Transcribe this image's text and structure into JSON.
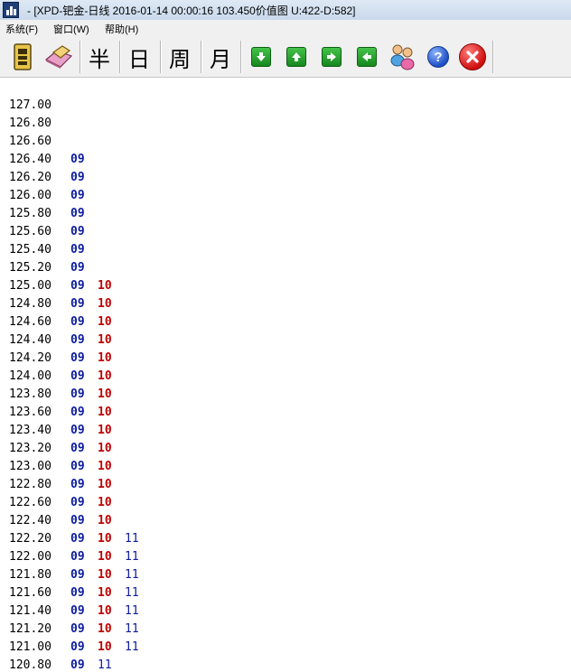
{
  "window": {
    "title": "- [XPD-钯金-日线 2016-01-14 00:00:16 103.450价值图 U:422-D:582]"
  },
  "menu": {
    "items": [
      "系统(F)",
      "窗口(W)",
      "帮助(H)"
    ]
  },
  "toolbar": {
    "buttons": [
      {
        "icon": "database-icon"
      },
      {
        "icon": "eraser-icon"
      },
      {
        "label": "半"
      },
      {
        "label": "日"
      },
      {
        "label": "周"
      },
      {
        "label": "月"
      },
      {
        "icon": "arrow-down-icon"
      },
      {
        "icon": "arrow-up-icon"
      },
      {
        "icon": "arrow-right-icon"
      },
      {
        "icon": "arrow-left-icon"
      },
      {
        "icon": "users-icon"
      },
      {
        "icon": "help-icon",
        "label": "?"
      },
      {
        "icon": "close-icon"
      }
    ]
  },
  "colors": {
    "c09": "#0b1ba0",
    "c10": "#c00000",
    "c11": "#0b1ba0"
  },
  "rows": [
    {
      "price": "127.00",
      "cols": []
    },
    {
      "price": "126.80",
      "cols": []
    },
    {
      "price": "126.60",
      "cols": []
    },
    {
      "price": "126.40",
      "cols": [
        "09"
      ]
    },
    {
      "price": "126.20",
      "cols": [
        "09"
      ]
    },
    {
      "price": "126.00",
      "cols": [
        "09"
      ]
    },
    {
      "price": "125.80",
      "cols": [
        "09"
      ]
    },
    {
      "price": "125.60",
      "cols": [
        "09"
      ]
    },
    {
      "price": "125.40",
      "cols": [
        "09"
      ]
    },
    {
      "price": "125.20",
      "cols": [
        "09"
      ]
    },
    {
      "price": "125.00",
      "cols": [
        "09",
        "10"
      ]
    },
    {
      "price": "124.80",
      "cols": [
        "09",
        "10"
      ]
    },
    {
      "price": "124.60",
      "cols": [
        "09",
        "10"
      ]
    },
    {
      "price": "124.40",
      "cols": [
        "09",
        "10"
      ]
    },
    {
      "price": "124.20",
      "cols": [
        "09",
        "10"
      ]
    },
    {
      "price": "124.00",
      "cols": [
        "09",
        "10"
      ]
    },
    {
      "price": "123.80",
      "cols": [
        "09",
        "10"
      ]
    },
    {
      "price": "123.60",
      "cols": [
        "09",
        "10"
      ]
    },
    {
      "price": "123.40",
      "cols": [
        "09",
        "10"
      ]
    },
    {
      "price": "123.20",
      "cols": [
        "09",
        "10"
      ]
    },
    {
      "price": "123.00",
      "cols": [
        "09",
        "10"
      ]
    },
    {
      "price": "122.80",
      "cols": [
        "09",
        "10"
      ]
    },
    {
      "price": "122.60",
      "cols": [
        "09",
        "10"
      ]
    },
    {
      "price": "122.40",
      "cols": [
        "09",
        "10"
      ]
    },
    {
      "price": "122.20",
      "cols": [
        "09",
        "10",
        "11"
      ]
    },
    {
      "price": "122.00",
      "cols": [
        "09",
        "10",
        "11"
      ]
    },
    {
      "price": "121.80",
      "cols": [
        "09",
        "10",
        "11"
      ]
    },
    {
      "price": "121.60",
      "cols": [
        "09",
        "10",
        "11"
      ]
    },
    {
      "price": "121.40",
      "cols": [
        "09",
        "10",
        "11"
      ]
    },
    {
      "price": "121.20",
      "cols": [
        "09",
        "10",
        "11"
      ]
    },
    {
      "price": "121.00",
      "cols": [
        "09",
        "10",
        "11"
      ]
    },
    {
      "price": "120.80",
      "cols": [
        "09",
        "11"
      ]
    }
  ]
}
